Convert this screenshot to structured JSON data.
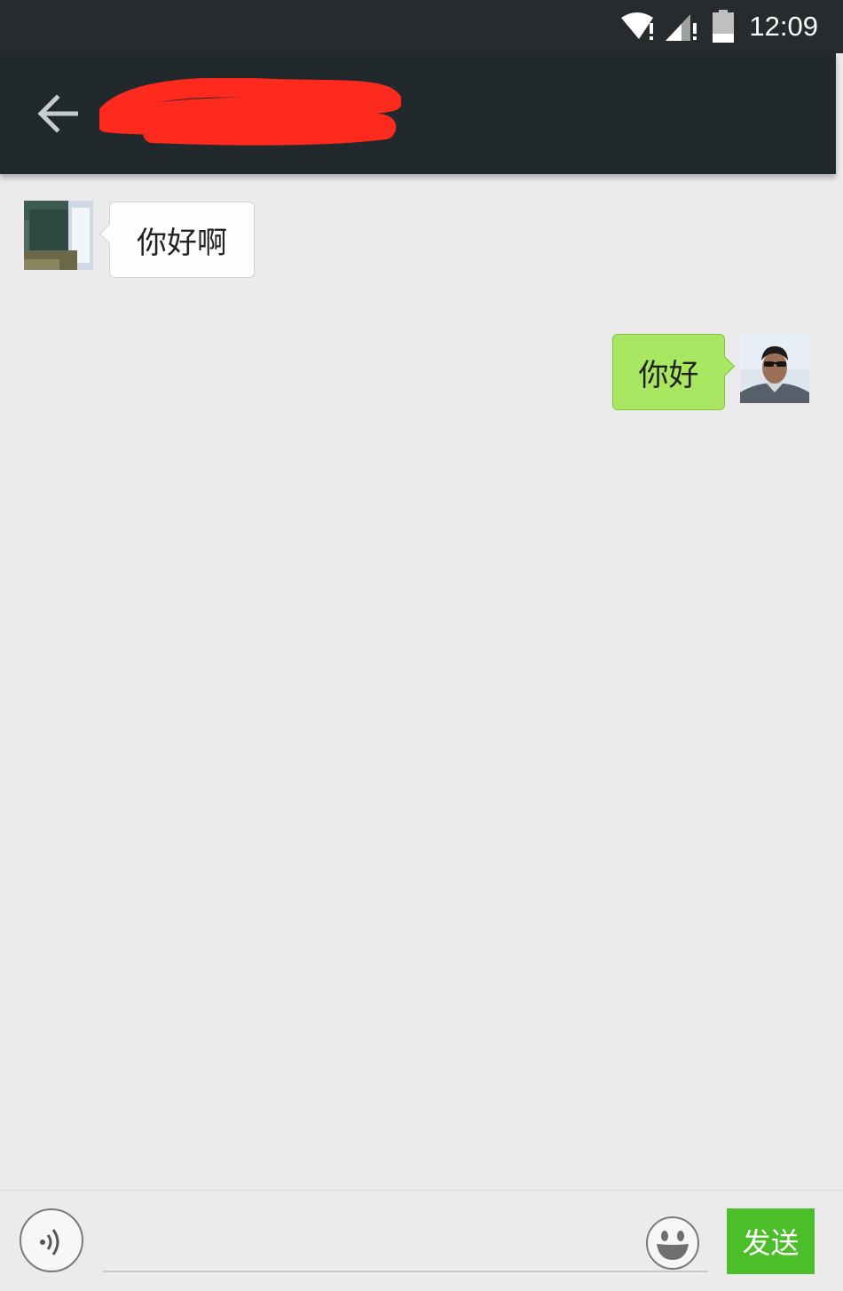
{
  "status_bar": {
    "time": "12:09",
    "icons": [
      "wifi-no-internet-icon",
      "cellular-signal-no-data-icon",
      "battery-icon"
    ]
  },
  "header": {
    "back_icon": "arrow-left-icon",
    "contact_name": "",
    "name_redacted": true
  },
  "messages": [
    {
      "direction": "incoming",
      "text": "你好啊",
      "avatar": "contact-avatar-photo"
    },
    {
      "direction": "outgoing",
      "text": "你好",
      "avatar": "user-avatar-photo"
    }
  ],
  "input_bar": {
    "voice_icon": "voice-input-icon",
    "input_value": "",
    "input_placeholder": "",
    "emoji_icon": "smiley-emoji-icon",
    "send_label": "发送"
  },
  "colors": {
    "status_bar_bg": "#262b2d",
    "title_bar_bg": "#22292c",
    "chat_bg": "#ebebeb",
    "incoming_bubble": "#fdfdfd",
    "outgoing_bubble": "#a9e661",
    "send_button": "#4bbe2a",
    "redaction": "#ff2a1e"
  }
}
